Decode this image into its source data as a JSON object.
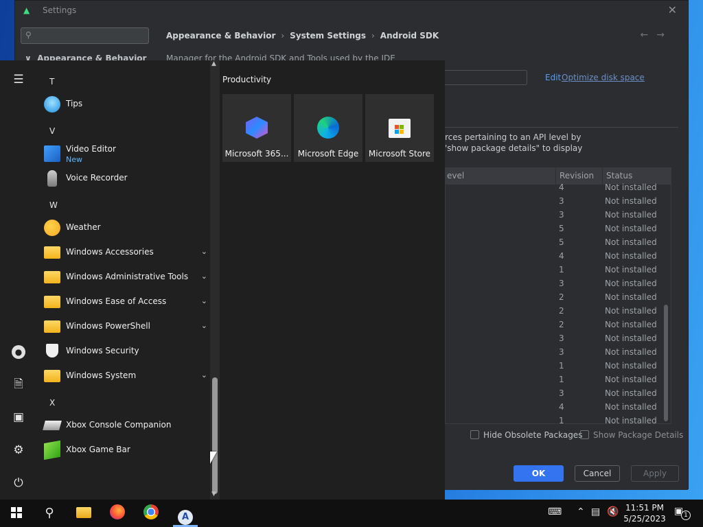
{
  "settings": {
    "title": "Settings",
    "search_placeholder": "",
    "sidebar_category": "Appearance & Behavior",
    "breadcrumb": [
      "Appearance & Behavior",
      "System Settings",
      "Android SDK"
    ],
    "description": "Manager for the Android SDK and Tools used by the IDE",
    "edit_label": "Edit",
    "optimize_label": "Optimize disk space",
    "info_line1": "rces pertaining to an API level by",
    "info_line2": "'show package details\" to display",
    "columns": {
      "level": "evel",
      "revision": "Revision",
      "status": "Status"
    },
    "rows": [
      {
        "rev": "4",
        "status": "Not installed"
      },
      {
        "rev": "3",
        "status": "Not installed"
      },
      {
        "rev": "3",
        "status": "Not installed"
      },
      {
        "rev": "5",
        "status": "Not installed"
      },
      {
        "rev": "5",
        "status": "Not installed"
      },
      {
        "rev": "4",
        "status": "Not installed"
      },
      {
        "rev": "1",
        "status": "Not installed"
      },
      {
        "rev": "3",
        "status": "Not installed"
      },
      {
        "rev": "2",
        "status": "Not installed"
      },
      {
        "rev": "2",
        "status": "Not installed"
      },
      {
        "rev": "2",
        "status": "Not installed"
      },
      {
        "rev": "3",
        "status": "Not installed"
      },
      {
        "rev": "3",
        "status": "Not installed"
      },
      {
        "rev": "1",
        "status": "Not installed"
      },
      {
        "rev": "1",
        "status": "Not installed"
      },
      {
        "rev": "3",
        "status": "Not installed"
      },
      {
        "rev": "4",
        "status": "Not installed"
      },
      {
        "rev": "1",
        "status": "Not installed"
      }
    ],
    "hide_obsolete_label": "Hide Obsolete Packages",
    "show_details_label": "Show Package Details",
    "ok_label": "OK",
    "cancel_label": "Cancel",
    "apply_label": "Apply"
  },
  "start_menu": {
    "letters": {
      "t": "T",
      "v": "V",
      "w": "W",
      "x": "X"
    },
    "apps": {
      "tips": "Tips",
      "video_editor": "Video Editor",
      "video_editor_badge": "New",
      "voice_recorder": "Voice Recorder",
      "weather": "Weather",
      "win_accessories": "Windows Accessories",
      "win_admin_tools": "Windows Administrative Tools",
      "win_ease": "Windows Ease of Access",
      "win_powershell": "Windows PowerShell",
      "win_security": "Windows Security",
      "win_system": "Windows System",
      "xbox_companion": "Xbox Console Companion",
      "xbox_gamebar": "Xbox Game Bar"
    },
    "group_title": "Productivity",
    "tiles": [
      "Microsoft 365...",
      "Microsoft Edge",
      "Microsoft Store"
    ]
  },
  "taskbar": {
    "time": "11:51 PM",
    "date": "5/25/2023",
    "notification_count": "1"
  }
}
